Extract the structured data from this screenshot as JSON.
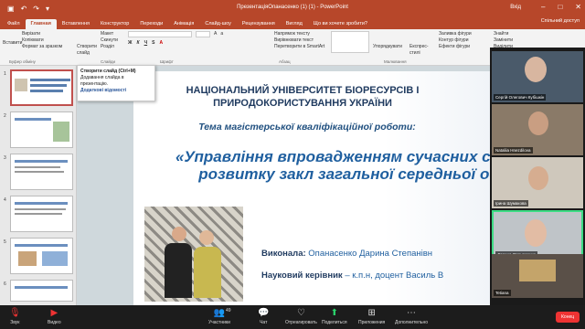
{
  "window": {
    "title": "ПрезентаціяОпанасенко (1) (1) - PowerPoint",
    "user": "Вхід",
    "save_icon": "save-icon"
  },
  "tabs": [
    "Файл",
    "Главная",
    "Вставлення",
    "Конструктор",
    "Переходи",
    "Анімація",
    "Слайд-шоу",
    "Рецензування",
    "Вигляд"
  ],
  "tellme": "Що ви хочете зробити?",
  "share": "Спільний доступ",
  "ribbon": {
    "clipboard": {
      "paste": "Вставити",
      "cut": "Вирізати",
      "copy": "Копіювати",
      "format": "Формат за зразком",
      "group": "Буфер обміну"
    },
    "slides": {
      "new": "Створити слайд",
      "layout": "Макет",
      "reset": "Скинути",
      "section": "Розділ",
      "group": "Слайди"
    },
    "font": {
      "group": "Шрифт"
    },
    "paragraph": {
      "direction": "Напрямок тексту",
      "align": "Вирівнювати текст",
      "smartart": "Перетворити в SmartArt",
      "group": "Абзац"
    },
    "drawing": {
      "arrange": "Упорядкувати",
      "styles": "Експрес-стилі",
      "fill": "Заливка фігури",
      "outline": "Контур фігури",
      "effects": "Ефекти фігури",
      "group": "Малювання"
    },
    "editing": {
      "find": "Знайти",
      "replace": "Замінити",
      "select": "Виділити",
      "group": "Редагування"
    }
  },
  "tooltip": {
    "title": "Створити слайд (Ctrl+M)",
    "body": "Додавання слайда в презентацію.",
    "link": "Додаткові відомості"
  },
  "thumbnails": [
    "1",
    "2",
    "3",
    "4",
    "5",
    "6"
  ],
  "slide": {
    "university": "НАЦІОНАЛЬНИЙ УНІВЕРСИТЕТ БІОРЕСУРСІВ І ПРИРОДОКОРИСТУВАННЯ УКРАЇНИ",
    "thesis_label": "Тема магістерської кваліфікаційної роботи:",
    "title": "«Управління впровадженням сучасних стратегій розвитку закл загальної середньої освіти»",
    "done_label": "Виконала:",
    "done_name": "Опанасенко Дарина Степанівн",
    "advisor_label": "Науковий керівник",
    "advisor_name": "– к.п.н, доцент Василь В"
  },
  "participants": [
    {
      "name": "Сергій Олегович Кубішкін"
    },
    {
      "name": "Nataliia Hnezdilova"
    },
    {
      "name": "Ірина Шумакова"
    },
    {
      "name": "Дарина Опанасенко"
    },
    {
      "name": "Tetiana"
    }
  ],
  "zoom_bar": {
    "audio": "Звук",
    "video": "Видео",
    "participants": "Участники",
    "participants_count": "49",
    "chat": "Чат",
    "react": "Отреагировать",
    "share": "Поделиться",
    "apps": "Приложения",
    "more": "Дополнительно",
    "end": "Конец"
  }
}
